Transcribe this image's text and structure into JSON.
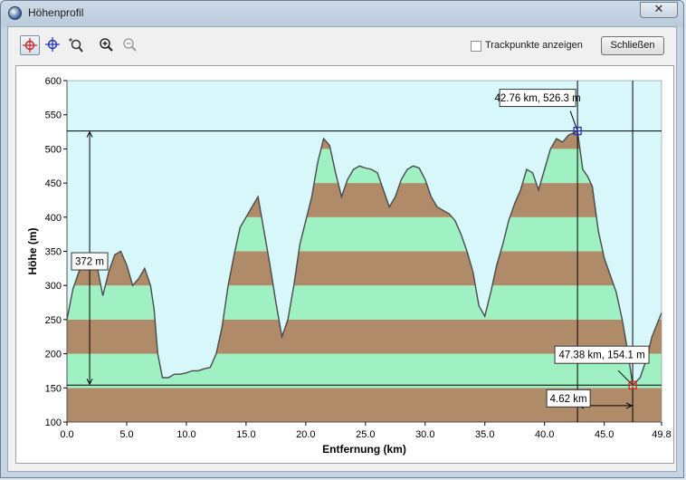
{
  "window": {
    "title": "Höhenprofil",
    "close_glyph": "✕"
  },
  "toolbar": {
    "tools": [
      {
        "name": "red-crosshair-tool",
        "icon": "red-crosshair-icon",
        "active": true
      },
      {
        "name": "blue-crosshair-tool",
        "icon": "blue-crosshair-icon",
        "active": false
      },
      {
        "name": "zoom-region-tool",
        "icon": "zoom-region-icon",
        "active": false
      },
      {
        "name": "zoom-in-tool",
        "icon": "zoom-in-icon",
        "active": false
      },
      {
        "name": "zoom-out-tool",
        "icon": "zoom-out-icon",
        "active": false
      }
    ],
    "checkbox_label": "Trackpunkte anzeigen",
    "checkbox_checked": false,
    "close_button_label": "Schließen"
  },
  "colors": {
    "plot_bg": "#d7f7fb",
    "band_green": "#9ff0c2",
    "band_brown": "#b08b6a",
    "line": "#4a4a4a"
  },
  "chart_data": {
    "type": "area",
    "xlabel": "Entfernung  (km)",
    "ylabel": "Höhe  (m)",
    "xlim": [
      0,
      49.8
    ],
    "ylim": [
      100,
      600
    ],
    "x_ticks": [
      "0.0",
      "5.0",
      "10.0",
      "15.0",
      "20.0",
      "25.0",
      "30.0",
      "35.0",
      "40.0",
      "45.0",
      "49.8"
    ],
    "y_ticks": [
      "100",
      "150",
      "200",
      "250",
      "300",
      "350",
      "400",
      "450",
      "500",
      "550",
      "600"
    ],
    "grid": false,
    "elevation_bands": [
      100,
      150,
      200,
      250,
      300,
      350,
      400,
      450,
      500,
      550,
      600
    ],
    "profile": {
      "x": [
        0,
        0.5,
        1,
        1.5,
        2,
        2.5,
        3,
        3.5,
        4,
        4.5,
        5,
        5.5,
        6,
        6.5,
        7,
        7.3,
        7.6,
        8,
        8.5,
        9,
        9.5,
        10,
        10.5,
        11,
        11.5,
        12,
        12.5,
        13,
        13.5,
        14,
        14.5,
        15,
        15.5,
        16,
        16.5,
        17,
        17.5,
        18,
        18.5,
        19,
        19.5,
        20,
        20.5,
        21,
        21.5,
        22,
        22.5,
        23,
        23.5,
        24,
        24.5,
        25,
        25.5,
        26,
        26.5,
        27,
        27.5,
        28,
        28.5,
        29,
        29.5,
        30,
        30.5,
        31,
        31.5,
        32,
        32.5,
        33,
        33.5,
        34,
        34.5,
        35,
        35.5,
        36,
        36.5,
        37,
        37.5,
        38,
        38.5,
        39,
        39.5,
        40,
        40.5,
        41,
        41.5,
        42,
        42.76,
        43.2,
        43.6,
        44,
        44.5,
        45,
        45.5,
        46,
        46.5,
        47,
        47.38,
        48,
        48.5,
        49,
        49.8
      ],
      "y": [
        250,
        295,
        320,
        335,
        340,
        330,
        285,
        320,
        345,
        350,
        330,
        300,
        310,
        325,
        300,
        265,
        200,
        165,
        165,
        170,
        170,
        172,
        175,
        175,
        178,
        180,
        200,
        240,
        300,
        345,
        385,
        400,
        415,
        430,
        380,
        330,
        275,
        225,
        250,
        300,
        360,
        395,
        430,
        480,
        515,
        505,
        465,
        430,
        455,
        470,
        475,
        472,
        470,
        465,
        440,
        415,
        430,
        455,
        470,
        475,
        472,
        455,
        430,
        415,
        410,
        405,
        395,
        375,
        350,
        320,
        270,
        255,
        290,
        330,
        360,
        395,
        420,
        440,
        470,
        465,
        440,
        470,
        500,
        515,
        510,
        520,
        526,
        470,
        460,
        445,
        380,
        340,
        315,
        290,
        250,
        200,
        154,
        165,
        190,
        225,
        260
      ]
    },
    "markers": [
      {
        "label": "42.76 km, 526.3 m",
        "x": 42.76,
        "y": 526.3,
        "color": "#2a2ad0"
      },
      {
        "label": "47.38 km, 154.1 m",
        "x": 47.38,
        "y": 154.1,
        "color": "#e02020"
      }
    ],
    "height_difference_label": "372 m",
    "distance_label": "4.62 km"
  }
}
